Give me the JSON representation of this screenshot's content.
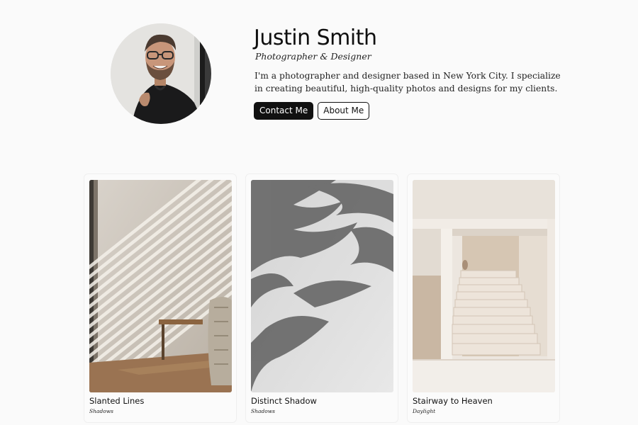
{
  "profile": {
    "name": "Justin Smith",
    "role": "Photographer & Designer",
    "bio": "I'm a photographer and designer based in New York City. I specialize in creating beautiful, high-quality photos and designs for my clients.",
    "contact_label": "Contact Me",
    "about_label": "About Me"
  },
  "gallery": [
    {
      "title": "Slanted Lines",
      "tag": "Shadows"
    },
    {
      "title": "Distinct Shadow",
      "tag": "Shadows"
    },
    {
      "title": "Stairway to Heaven",
      "tag": "Daylight"
    }
  ],
  "colors": {
    "background": "#fafafa",
    "button_dark": "#111111",
    "text": "#111111"
  }
}
